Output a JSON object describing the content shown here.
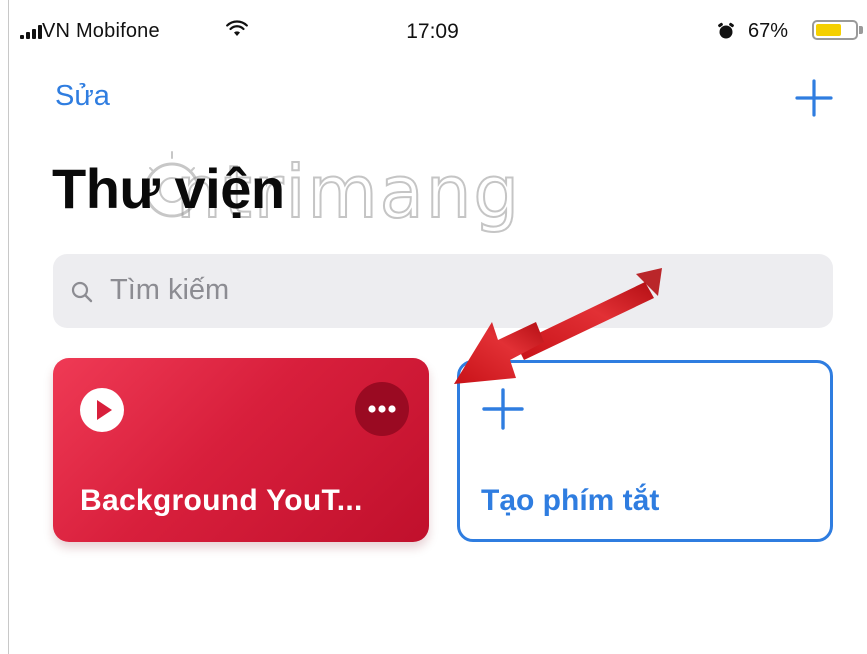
{
  "status_bar": {
    "carrier": "VN Mobifone",
    "time": "17:09",
    "battery_percent": "67%",
    "battery_level": 0.67,
    "icons": [
      "signal-icon",
      "wifi-icon",
      "alarm-icon",
      "battery-icon"
    ]
  },
  "nav": {
    "edit_label": "Sửa",
    "add_icon": "plus-icon"
  },
  "page": {
    "title": "Thư viện"
  },
  "watermark": {
    "text": "ntrimang"
  },
  "search": {
    "placeholder": "Tìm kiếm",
    "icon": "search-icon"
  },
  "shortcuts": [
    {
      "label": "Background YouT...",
      "icon": "play-icon",
      "more_icon": "more-icon"
    }
  ],
  "create_card": {
    "label": "Tạo phím tắt",
    "icon": "plus-icon"
  },
  "colors": {
    "accent": "#2f7de0",
    "shortcut_card": "#d81f3c",
    "annotation_arrow": "#d9262b",
    "search_bg": "#ededf0"
  }
}
